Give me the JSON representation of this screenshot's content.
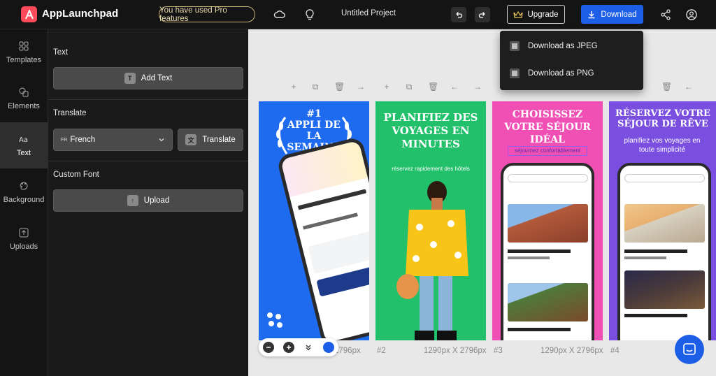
{
  "app": {
    "brand": "AppLaunchpad",
    "pro_notice": "You have used Pro features",
    "project_title": "Untitled Project",
    "upgrade_label": "Upgrade",
    "download_label": "Download"
  },
  "download_menu": {
    "items": [
      {
        "label": "Download as JPEG"
      },
      {
        "label": "Download as PNG"
      }
    ]
  },
  "nav": {
    "items": [
      {
        "label": "Templates",
        "icon": "templates-icon"
      },
      {
        "label": "Elements",
        "icon": "elements-icon"
      },
      {
        "label": "Text",
        "icon": "text-icon",
        "active": true
      },
      {
        "label": "Background",
        "icon": "background-icon"
      },
      {
        "label": "Uploads",
        "icon": "uploads-icon"
      }
    ]
  },
  "panel": {
    "text_heading": "Text",
    "add_text_label": "Add Text",
    "translate_heading": "Translate",
    "language_code": "FR",
    "language_selected": "French",
    "translate_label": "Translate",
    "custom_font_heading": "Custom Font",
    "upload_label": "Upload"
  },
  "canvas": {
    "cards": [
      {
        "headline_1": "#1",
        "headline_2": "APPLI DE",
        "headline_3": "LA",
        "headline_4": "SEMAINE",
        "bg": "#1f6bf0"
      },
      {
        "headline": "PLANIFIEZ DES VOYAGES EN MINUTES",
        "sub": "réservez rapidement des hôtels",
        "bg": "#22c06a"
      },
      {
        "headline": "CHOISISSEZ VOTRE SÉJOUR IDÉAL",
        "sub": "séjournez confortablement",
        "bg": "#f04fb4"
      },
      {
        "headline": "RÉSERVEZ VOTRE SÉJOUR DE RÊVE",
        "sub": "planifiez vos voyages en toute simplicité",
        "bg": "#7a4fe0"
      }
    ],
    "labels": [
      {
        "num": "",
        "size": "2796px"
      },
      {
        "num": "#2",
        "size": "1290px X 2796px"
      },
      {
        "num": "#3",
        "size": "1290px X 2796px"
      },
      {
        "num": "#4",
        "size": ""
      }
    ]
  },
  "colors": {
    "accent_blue": "#1c5ee6",
    "logo_red": "#ff4a5a",
    "topbar": "#141414"
  }
}
